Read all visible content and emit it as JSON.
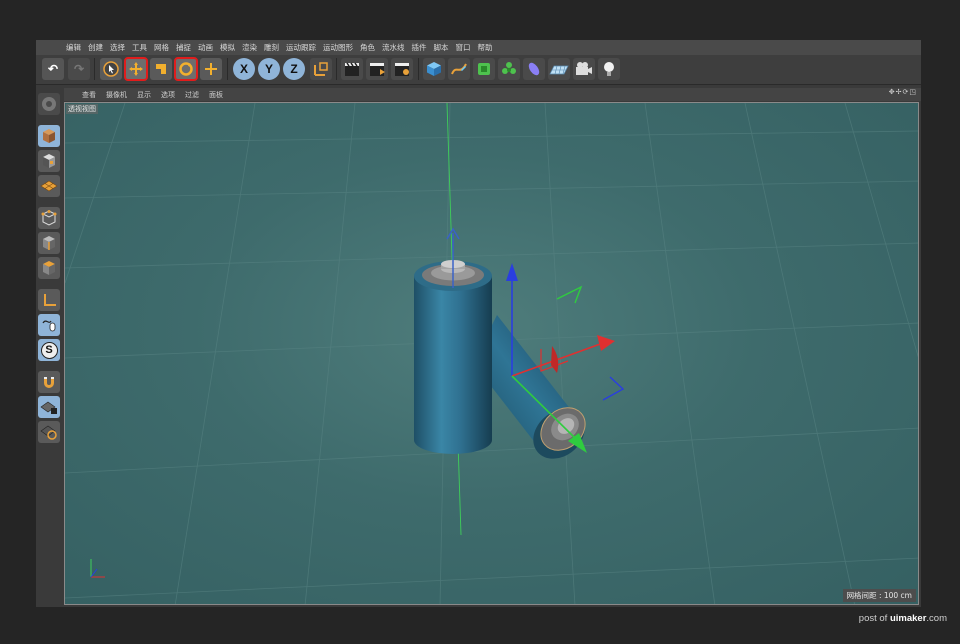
{
  "menu": [
    "编辑",
    "创建",
    "选择",
    "工具",
    "网格",
    "捕捉",
    "动画",
    "模拟",
    "渲染",
    "雕刻",
    "运动跟踪",
    "运动图形",
    "角色",
    "流水线",
    "插件",
    "脚本",
    "窗口",
    "帮助"
  ],
  "viewport": {
    "header_menu": [
      "查看",
      "摄像机",
      "显示",
      "选项",
      "过滤",
      "面板"
    ],
    "label": "透视视图",
    "grid_info": "网格间距 : 100 cm",
    "nav_icons": "✥✢⟳◳"
  },
  "toolbar": {
    "axis_x": "X",
    "axis_y": "Y",
    "axis_z": "Z"
  },
  "leftbar": {
    "snap_label": "S"
  },
  "credit": {
    "prefix": "post of ",
    "brand": "uimaker",
    "suffix": ".com"
  },
  "colors": {
    "highlight": "#e01c1c",
    "viewport_bg": "#3e6b6c",
    "cylinder": "#2f6f8c",
    "gizmo_x": "#e03030",
    "gizmo_y": "#2fcc3f",
    "gizmo_z": "#2a3ee0"
  }
}
